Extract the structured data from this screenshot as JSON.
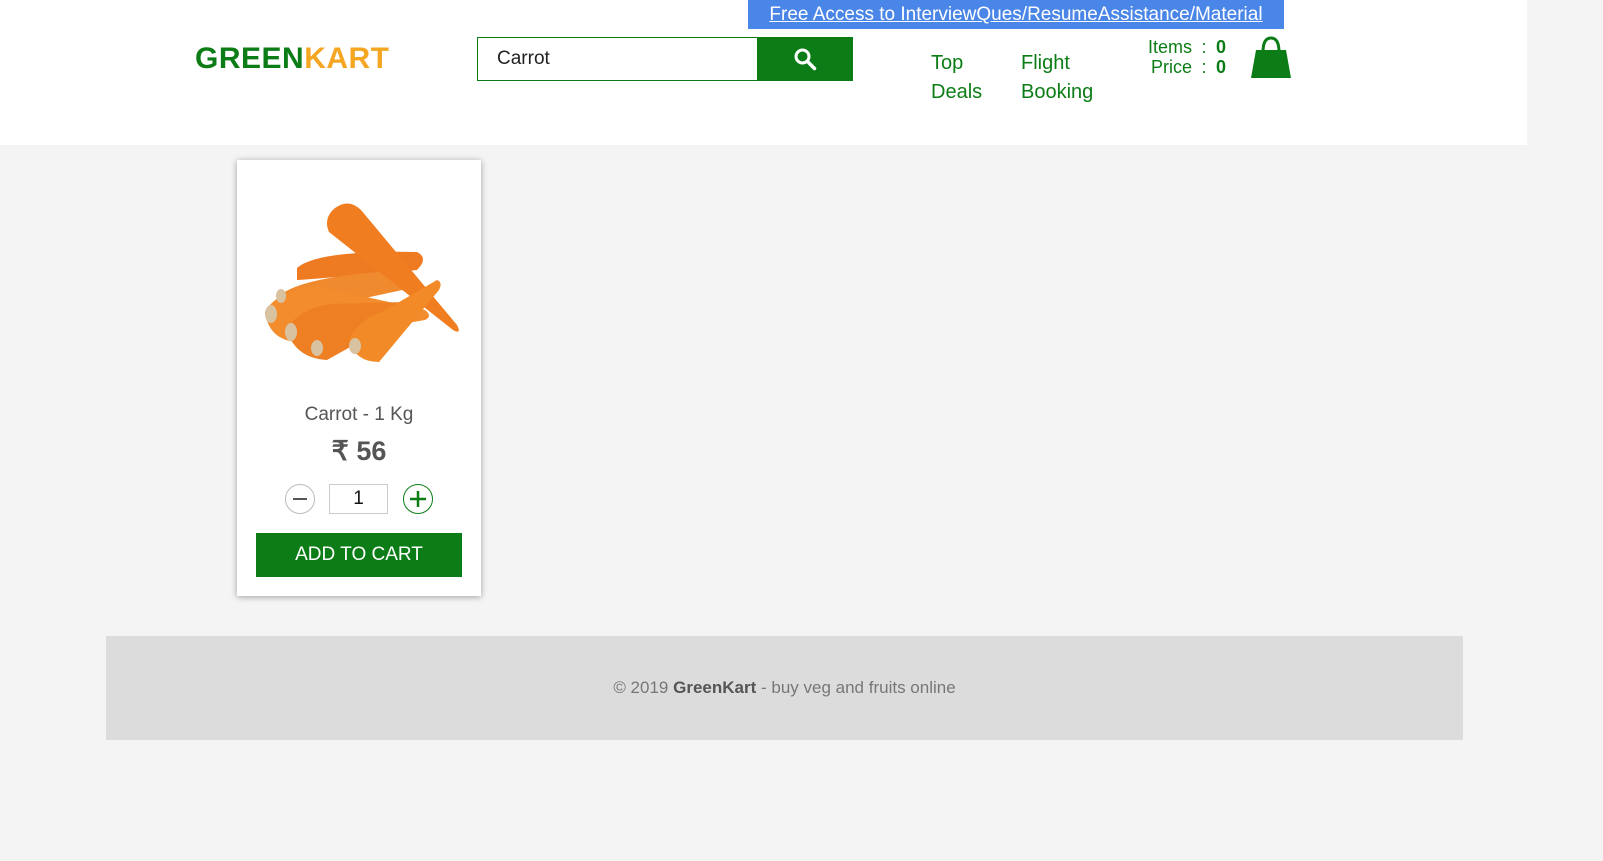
{
  "promo": {
    "label": "Free Access to InterviewQues/ResumeAssistance/Material"
  },
  "logo": {
    "part1": "GREEN",
    "part2": "KART"
  },
  "search": {
    "value": "Carrot"
  },
  "nav": {
    "top_deals": "Top Deals",
    "flight_booking": "Flight Booking"
  },
  "cart": {
    "items_label": "Items",
    "items_value": "0",
    "price_label": "Price",
    "price_value": "0",
    "separator": ":"
  },
  "product": {
    "name": "Carrot - 1 Kg",
    "price": "₹ 56",
    "quantity": "1",
    "add_label": "ADD TO CART"
  },
  "footer": {
    "copyright": "© 2019",
    "brand": "GreenKart",
    "tagline": "- buy veg and fruits online"
  },
  "colors": {
    "brand_green": "#0c7d16",
    "brand_orange": "#f5a623",
    "promo_blue": "#4a86e8"
  },
  "icons": {
    "search": "search-icon",
    "cart": "shopping-bag-icon",
    "minus": "minus-icon",
    "plus": "plus-icon"
  }
}
